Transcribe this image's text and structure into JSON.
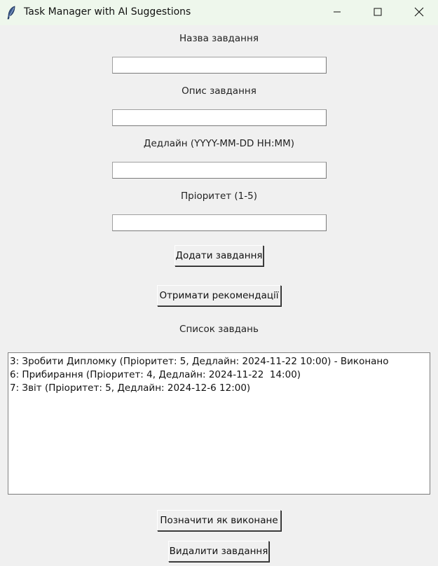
{
  "window": {
    "title": "Task Manager with AI Suggestions",
    "icon": "feather-icon",
    "controls": [
      "minimize-icon",
      "maximize-icon",
      "close-icon"
    ]
  },
  "form": {
    "name_label": "Назва завдання",
    "name_value": "",
    "description_label": "Опис завдання",
    "description_value": "",
    "deadline_label": "Дедлайн (YYYY-MM-DD HH:MM)",
    "deadline_value": "",
    "priority_label": "Пріоритет (1-5)",
    "priority_value": "",
    "add_button": "Додати завдання",
    "suggest_button": "Отримати рекомендації"
  },
  "tasks": {
    "header": "Список завдань",
    "items": [
      "3: Зробити Дипломку (Пріоритет: 5, Дедлайн: 2024-11-22 10:00) - Виконано",
      "6: Прибирання (Пріоритет: 4, Дедлайн: 2024-11-22  14:00)",
      "7: Звіт (Пріоритет: 5, Дедлайн: 2024-12-6 12:00)"
    ],
    "mark_done_button": "Позначити як виконане",
    "delete_button": "Видалити завдання"
  }
}
